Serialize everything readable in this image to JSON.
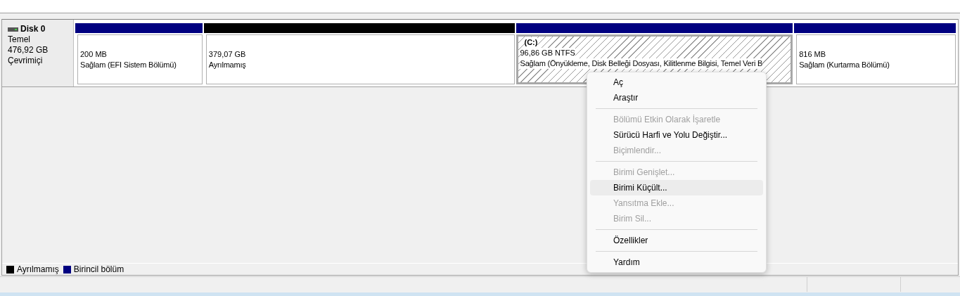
{
  "disk": {
    "name": "Disk 0",
    "type": "Temel",
    "size": "476,92 GB",
    "status": "Çevrimiçi"
  },
  "partitions": [
    {
      "kind": "primary",
      "selected": false,
      "size": "200 MB",
      "status": "Sağlam (EFI Sistem Bölümü)"
    },
    {
      "kind": "unallocated",
      "selected": false,
      "size": "379,07 GB",
      "status": "Ayrılmamış"
    },
    {
      "kind": "primary",
      "selected": true,
      "label": "(C:)",
      "size": "96,86 GB NTFS",
      "status": "Sağlam (Önyükleme, Disk Belleği Dosyası, Kilitlenme Bilgisi, Temel Veri B"
    },
    {
      "kind": "primary",
      "selected": false,
      "size": "816 MB",
      "status": "Sağlam (Kurtarma Bölümü)"
    }
  ],
  "context_menu": [
    {
      "kind": "item",
      "label": "Aç",
      "disabled": false,
      "highlighted": false
    },
    {
      "kind": "item",
      "label": "Araştır",
      "disabled": false,
      "highlighted": false
    },
    {
      "kind": "separator"
    },
    {
      "kind": "item",
      "label": "Bölümü Etkin Olarak İşaretle",
      "disabled": true,
      "highlighted": false
    },
    {
      "kind": "item",
      "label": "Sürücü Harfi ve Yolu Değiştir...",
      "disabled": false,
      "highlighted": false
    },
    {
      "kind": "item",
      "label": "Biçimlendir...",
      "disabled": true,
      "highlighted": false
    },
    {
      "kind": "separator"
    },
    {
      "kind": "item",
      "label": "Birimi Genişlet...",
      "disabled": true,
      "highlighted": false
    },
    {
      "kind": "item",
      "label": "Birimi Küçült...",
      "disabled": false,
      "highlighted": true
    },
    {
      "kind": "item",
      "label": "Yansıtma Ekle...",
      "disabled": true,
      "highlighted": false
    },
    {
      "kind": "item",
      "label": "Birim Sil...",
      "disabled": true,
      "highlighted": false
    },
    {
      "kind": "separator"
    },
    {
      "kind": "item",
      "label": "Özellikler",
      "disabled": false,
      "highlighted": false
    },
    {
      "kind": "separator"
    },
    {
      "kind": "item",
      "label": "Yardım",
      "disabled": false,
      "highlighted": false
    }
  ],
  "legend": [
    {
      "label": "Ayrılmamış",
      "color": "#000000"
    },
    {
      "label": "Birincil bölüm",
      "color": "#000080"
    }
  ]
}
